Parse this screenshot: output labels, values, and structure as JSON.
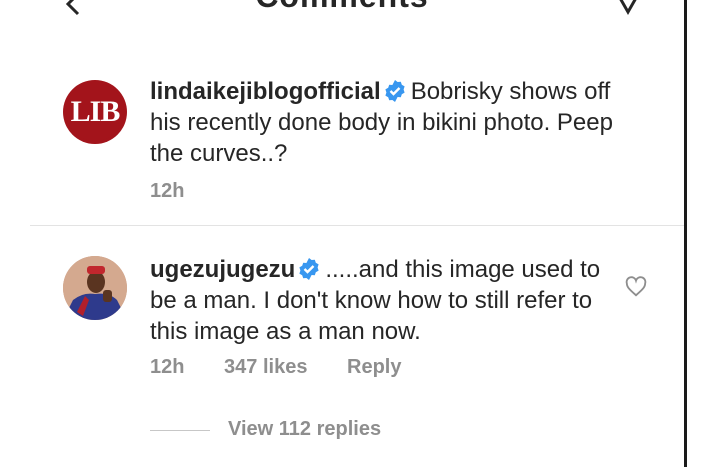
{
  "header": {
    "title": "Comments",
    "back_icon": "chevron-left-icon",
    "dm_icon": "direct-message-icon"
  },
  "caption": {
    "username": "lindaikejiblogofficial",
    "verified": true,
    "avatar_text": "LIB",
    "text": "Bobrisky shows off his recently done body in bikini photo. Peep the curves..?",
    "time": "12h"
  },
  "comments": [
    {
      "username": "ugezujugezu",
      "verified": true,
      "text": ".....and this image used to be a man. I don't know how to still refer to this image as a man now.",
      "time": "12h",
      "likes": "347 likes",
      "reply_label": "Reply",
      "view_replies": "View 112 replies"
    }
  ],
  "colors": {
    "verified": "#3897f0",
    "lib_red": "#a3141b",
    "meta": "#8e8e8e"
  }
}
